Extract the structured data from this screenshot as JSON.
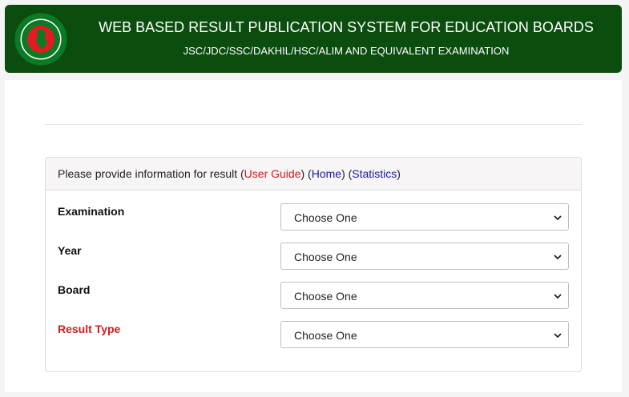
{
  "header": {
    "title": "WEB BASED RESULT PUBLICATION SYSTEM FOR EDUCATION BOARDS",
    "subtitle": "JSC/JDC/SSC/DAKHIL/HSC/ALIM AND EQUIVALENT EXAMINATION",
    "logo_icon": "bangladesh-govt-seal-icon",
    "colors": {
      "background": "#0b4d0f",
      "text": "#ffffff"
    }
  },
  "panel": {
    "intro": "Please provide information for result (",
    "user_guide": "User Guide",
    "sep1": ") (",
    "home": "Home",
    "sep2": ") (",
    "statistics": "Statistics",
    "end": ")"
  },
  "form": {
    "fields": [
      {
        "label": "Examination",
        "value": "Choose One"
      },
      {
        "label": "Year",
        "value": "Choose One"
      },
      {
        "label": "Board",
        "value": "Choose One"
      },
      {
        "label": "Result Type",
        "value": "Choose One"
      }
    ]
  },
  "colors": {
    "link_red": "#d41a1a",
    "link_blue": "#1a1aa8"
  }
}
